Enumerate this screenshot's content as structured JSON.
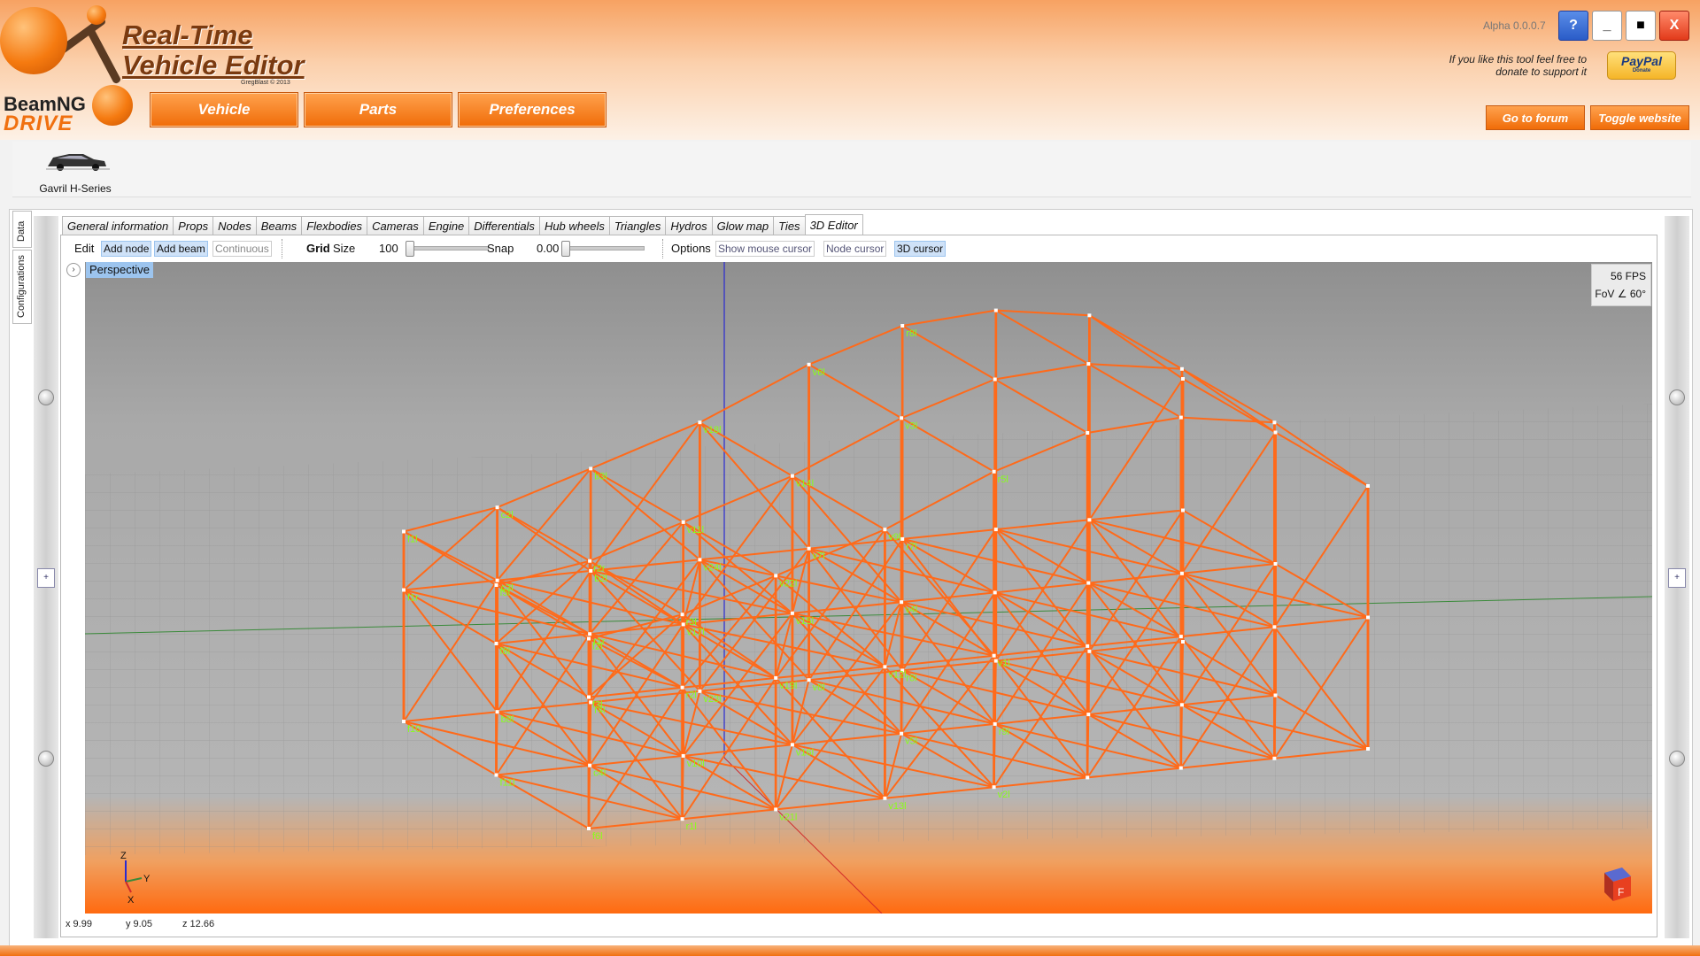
{
  "header": {
    "brand_beam": "BeamNG",
    "brand_drive": "DRIVE",
    "title_line1": "Real-Time",
    "title_line2": "Vehicle Editor",
    "credit": "GregBlast © 2013",
    "version": "Alpha 0.0.0.7",
    "donate_text": "If you like this tool feel free to donate to support it",
    "paypal_label": "PayPal",
    "paypal_sub": "Donate",
    "forum_button": "Go to forum",
    "website_button": "Toggle website",
    "help_button": "?",
    "minimize_button": "_",
    "maximize_button": "■",
    "close_button": "X"
  },
  "nav": {
    "vehicle": "Vehicle",
    "parts": "Parts",
    "preferences": "Preferences"
  },
  "vehicle_strip": {
    "vehicle_name": "Gavril H-Series"
  },
  "side_tabs": {
    "data": "Data",
    "configurations": "Configurations"
  },
  "tabs": [
    "General information",
    "Props",
    "Nodes",
    "Beams",
    "Flexbodies",
    "Cameras",
    "Engine",
    "Differentials",
    "Hub wheels",
    "Triangles",
    "Hydros",
    "Glow map",
    "Ties",
    "3D Editor"
  ],
  "active_tab": "3D Editor",
  "toolbar": {
    "edit_label": "Edit",
    "add_node": "Add node",
    "add_beam": "Add beam",
    "continuous": "Continuous",
    "grid_label": "Grid",
    "size_label": "Size",
    "size_value": "100",
    "snap_label": "Snap",
    "snap_value": "0.00",
    "options_label": "Options",
    "show_mouse_cursor": "Show mouse cursor",
    "node_cursor": "Node cursor",
    "cursor_3d": "3D cursor"
  },
  "viewport": {
    "view_name": "Perspective",
    "fps": "56 FPS",
    "fov": "FoV ∠ 60°",
    "axis_x": "X",
    "axis_y": "Y",
    "axis_z": "Z",
    "cube_face": "F"
  },
  "node_labels": [
    "f10",
    "f1r",
    "f1l",
    "f11l",
    "f8l",
    "f5l",
    "f6l",
    "f3l",
    "f2l",
    "b8l",
    "c3l",
    "c2l",
    "c4l",
    "r1r",
    "r2r",
    "r1l",
    "r2l",
    "r3l",
    "r4l",
    "b2l",
    "b3l",
    "v10l",
    "v17l",
    "v11l",
    "v21l",
    "v19l",
    "v22l",
    "v23l",
    "v24l",
    "v18l",
    "v16l",
    "v15l",
    "v14l",
    "v13l",
    "v12l",
    "v9l",
    "v8l",
    "v7l",
    "v6l",
    "v5l",
    "v4l",
    "v3l",
    "v2l",
    "v1l",
    "r5l",
    "r6l",
    "r7l",
    "r8l",
    "r9l"
  ],
  "status": {
    "x": "x 9.99",
    "y": "y 9.05",
    "z": "z 12.66"
  },
  "colors": {
    "accent": "#f26d0f",
    "wireframe": "#ff6a1a",
    "node_label": "#88ff1a",
    "viewport_bg": "#a9a9a9",
    "selection_blue": "#9cc4ee"
  }
}
